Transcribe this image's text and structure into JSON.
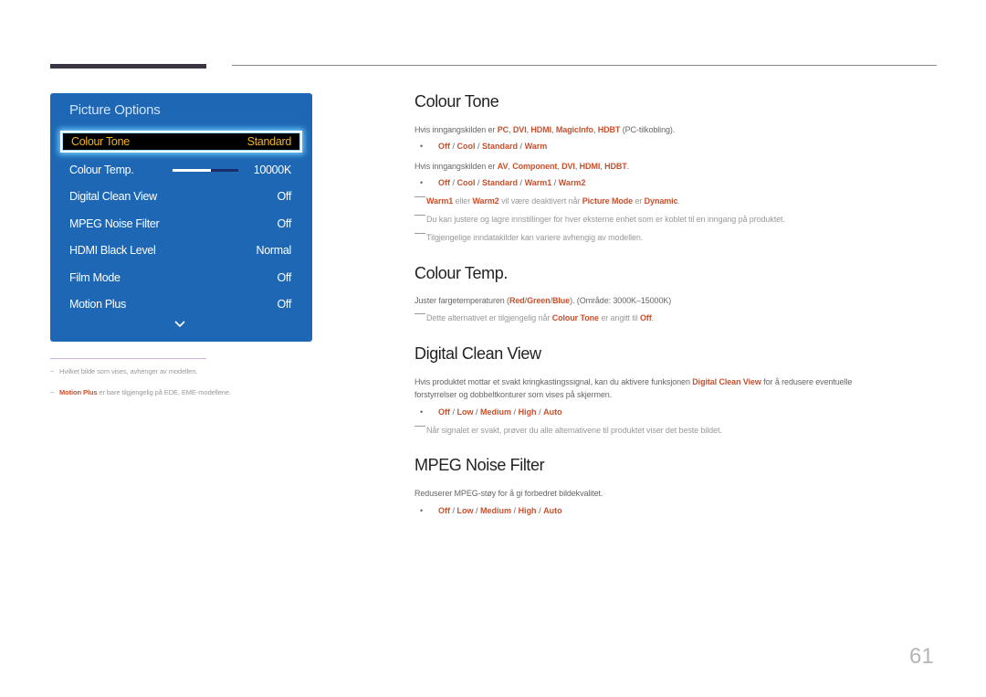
{
  "page_number": "61",
  "osd": {
    "title": "Picture Options",
    "items": [
      {
        "label": "Colour Tone",
        "value": "Standard",
        "selected": true
      },
      {
        "label": "Colour Temp.",
        "value": "10000K",
        "slider_fraction": 0.58
      },
      {
        "label": "Digital Clean View",
        "value": "Off"
      },
      {
        "label": "MPEG Noise Filter",
        "value": "Off"
      },
      {
        "label": "HDMI Black Level",
        "value": "Normal"
      },
      {
        "label": "Film Mode",
        "value": "Off"
      },
      {
        "label": "Motion Plus",
        "value": "Off"
      }
    ],
    "more_icon": "chevron-down-icon",
    "colors": {
      "panel": "#1e67b4",
      "selected_text": "#f0b323",
      "glow": "#6fd0ff"
    }
  },
  "left_notes": [
    {
      "text": "Hvilket bilde som vises, avhenger av modellen."
    },
    {
      "highlight": "Motion Plus",
      "text": " er bare tilgjengelig på EDE, EME-modellene."
    }
  ],
  "accent_color": "#c8502c",
  "sections": {
    "colour_tone": {
      "title": "Colour Tone",
      "line1_prefix": "Hvis inngangskilden er ",
      "line1_sources": [
        "PC",
        "DVI",
        "HDMI",
        "MagicInfo",
        "HDBT"
      ],
      "line1_suffix": " (PC-tilkobling).",
      "options1": [
        "Off",
        "Cool",
        "Standard",
        "Warm"
      ],
      "line2_prefix": "Hvis inngangskilden er ",
      "line2_sources": [
        "AV",
        "Component",
        "DVI",
        "HDMI",
        "HDBT"
      ],
      "line2_suffix": ".",
      "options2": [
        "Off",
        "Cool",
        "Standard",
        "Warm1",
        "Warm2"
      ],
      "note1": {
        "a": "Warm1",
        "t1": " eller ",
        "b": "Warm2",
        "t2": " vil være deaktivert når ",
        "c": "Picture Mode",
        "t3": " er ",
        "d": "Dynamic",
        "t4": "."
      },
      "note2": "Du kan justere og lagre innstillinger for hver eksterne enhet som er koblet til en inngang på produktet.",
      "note3": "Tilgjengelige inndatakilder kan variere avhengig av modellen."
    },
    "colour_temp": {
      "title": "Colour Temp.",
      "desc_prefix": "Juster fargetemperaturen (",
      "colors": [
        "Red",
        "Green",
        "Blue"
      ],
      "desc_suffix": "). (Område: 3000K–15000K)",
      "note": {
        "t1": "Dette alternativet er tilgjengelig når ",
        "a": "Colour Tone",
        "t2": " er angitt til ",
        "b": "Off",
        "t3": "."
      }
    },
    "digital_clean_view": {
      "title": "Digital Clean View",
      "desc_prefix": "Hvis produktet mottar et svakt kringkastingssignal, kan du aktivere funksjonen ",
      "desc_highlight": "Digital Clean View",
      "desc_suffix": " for å redusere eventuelle",
      "desc_line2": "forstyrrelser og dobbeltkonturer som vises på skjermen.",
      "options": [
        "Off",
        "Low",
        "Medium",
        "High",
        "Auto"
      ],
      "note": "Når signalet er svakt, prøver du alle alternativene til produktet viser det beste bildet."
    },
    "mpeg_noise_filter": {
      "title": "MPEG Noise Filter",
      "desc": "Reduserer MPEG-støy for å gi forbedret bildekvalitet.",
      "options": [
        "Off",
        "Low",
        "Medium",
        "High",
        "Auto"
      ]
    }
  }
}
